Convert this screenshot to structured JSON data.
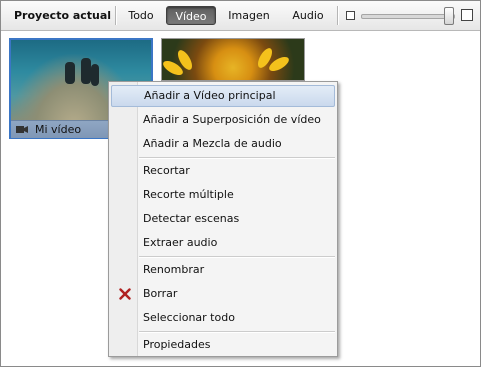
{
  "toolbar": {
    "title": "Proyecto actual",
    "tabs": [
      {
        "label": "Todo",
        "active": false
      },
      {
        "label": "Vídeo",
        "active": true
      },
      {
        "label": "Imagen",
        "active": false
      },
      {
        "label": "Audio",
        "active": false
      }
    ],
    "zoom_level": 0.95
  },
  "clips": [
    {
      "name": "Mi vídeo",
      "type": "video",
      "selected": true
    },
    {
      "name": "",
      "type": "image",
      "selected": false
    }
  ],
  "context_menu": {
    "items": [
      "Añadir a Vídeo principal",
      "Añadir a Superposición de vídeo",
      "Añadir a Mezcla de audio",
      "Recortar",
      "Recorte múltiple",
      "Detectar escenas",
      "Extraer audio",
      "Renombrar",
      "Borrar",
      "Seleccionar todo",
      "Propiedades"
    ],
    "highlighted": "Añadir a Vídeo principal",
    "delete_icon": "red-x-icon"
  },
  "colors": {
    "selection": "#3b76c5",
    "active_tab": "#5f5f5f",
    "delete_icon": "#b02020"
  }
}
